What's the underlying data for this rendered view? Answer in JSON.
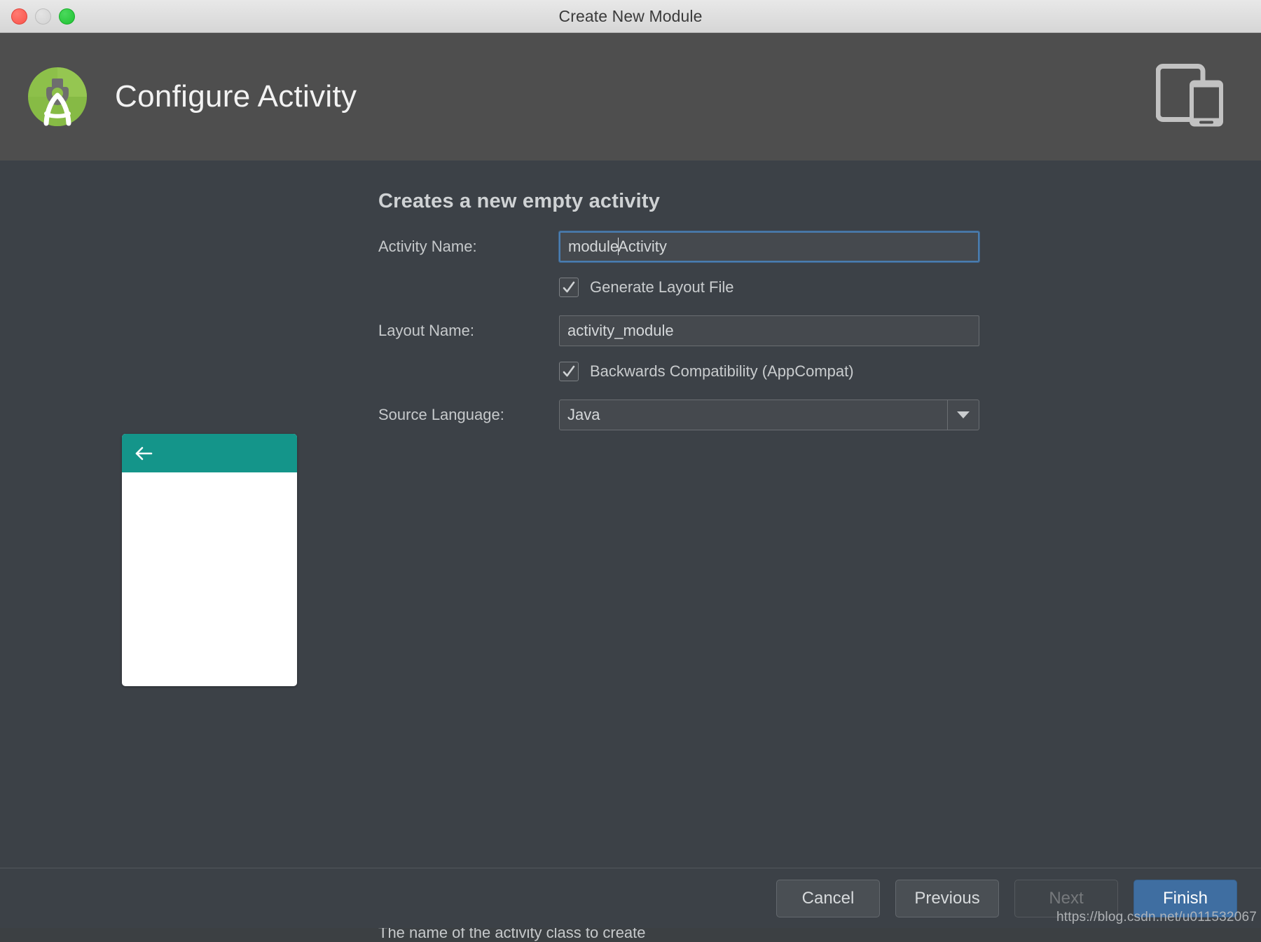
{
  "window": {
    "title": "Create New Module",
    "controls": {
      "close": "close-button",
      "minimize": "minimize-button",
      "maximize": "maximize-button"
    }
  },
  "header": {
    "title": "Configure Activity",
    "logo_icon": "android-studio-logo-icon",
    "logo_color": "#8bc34a",
    "device_icon": "tablet-and-phone-icon",
    "background": "#4e4e4e"
  },
  "preview": {
    "name": "activity-preview-thumbnail",
    "appbar_color": "#14958a",
    "body_color": "#ffffff",
    "back_icon": "back-arrow-icon"
  },
  "main": {
    "section_title": "Creates a new empty activity",
    "fields": {
      "activity_name": {
        "label": "Activity Name:",
        "value_before_caret": "module",
        "value_after_caret": "Activity",
        "full_value": "moduleActivity",
        "focused": true,
        "focus_color": "#4a7db0"
      },
      "layout_name": {
        "label": "Layout Name:",
        "value": "activity_module",
        "focused": false
      },
      "source_language": {
        "label": "Source Language:",
        "value": "Java",
        "dropdown_icon": "chevron-down-icon"
      }
    },
    "checkboxes": [
      {
        "label": "Generate Layout File",
        "checked": true
      },
      {
        "label": "Backwards Compatibility (AppCompat)",
        "checked": true
      }
    ],
    "hint": "The name of the activity class to create"
  },
  "footer": {
    "buttons": [
      {
        "label": "Cancel",
        "state": "enabled"
      },
      {
        "label": "Previous",
        "state": "enabled"
      },
      {
        "label": "Next",
        "state": "disabled"
      },
      {
        "label": "Finish",
        "state": "primary"
      }
    ],
    "watermark": "https://blog.csdn.net/u011532067"
  }
}
